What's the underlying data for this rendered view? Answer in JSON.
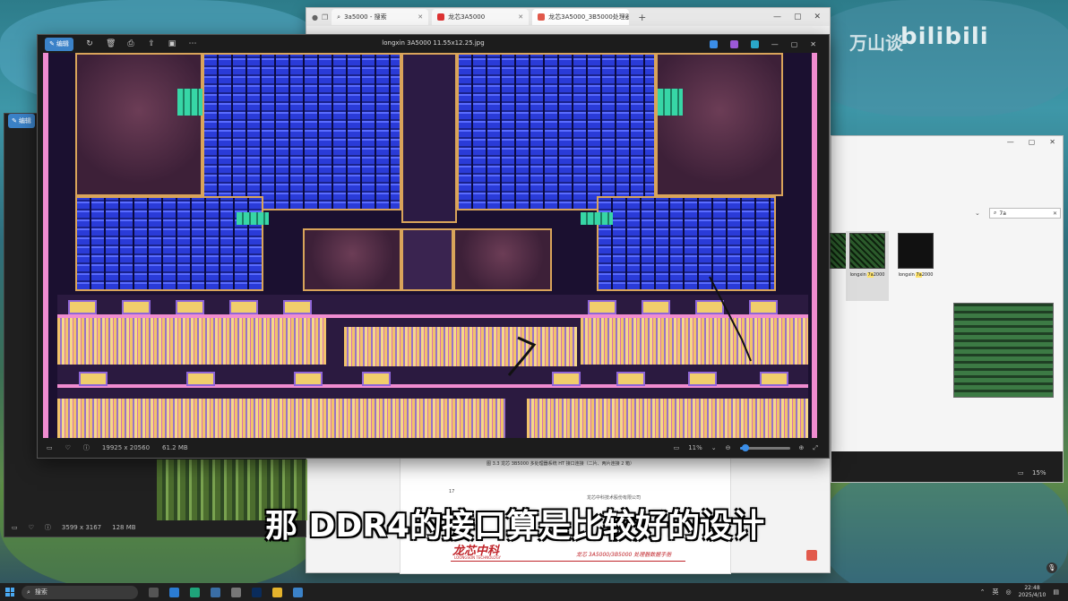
{
  "watermark": {
    "brand": "bilibili",
    "channel": "万山谈"
  },
  "browser": {
    "tabs": [
      {
        "label": "3a5000 - 搜索"
      },
      {
        "label": "龙芯3A5000"
      },
      {
        "label": "龙芯3A5000_3B5000处理器数据..."
      }
    ],
    "pdf": {
      "caption": "图 3.3 龙芯 3B5000 多处理器系统 HT 接口连接（二片、两片连接 2 箱）",
      "page_number": "17",
      "company": "龙芯中科技术股份有限公司",
      "logo": "龙芯中科",
      "logo_en": "LOONGSON TECHNOLOGY",
      "doc_title": "龙芯 3A5000/3B5000 处理器数据手册"
    }
  },
  "photos_small": {
    "edit_label": "编辑",
    "dimensions": "3599 x 3167",
    "filesize": "128 MB"
  },
  "explorer": {
    "search_value": "7a",
    "files": [
      {
        "name_prefix": "longxin ",
        "name_hl": "7a",
        "name_suffix": "2000"
      },
      {
        "name_prefix": "longxin ",
        "name_hl": "7a",
        "name_suffix": "2000"
      }
    ],
    "zoom": "15%"
  },
  "viewer": {
    "edit_label": "编辑",
    "filename": "longxin 3A5000 11.55x12.25.jpg",
    "dimensions": "19925 x 20560",
    "filesize": "61.2 MB",
    "zoom": "11%",
    "zoom_fraction": 0.11
  },
  "subtitle": "那 DDR4的接口算是比较好的设计",
  "taskbar": {
    "search_label": "搜索",
    "ime": "英",
    "time": "22:48",
    "date": "2025/4/10"
  },
  "colors": {
    "accent": "#3b82c8",
    "chip_blue": "#2a3bd8",
    "chip_gold": "#d9a45a",
    "pdf_red": "#c0242a"
  }
}
